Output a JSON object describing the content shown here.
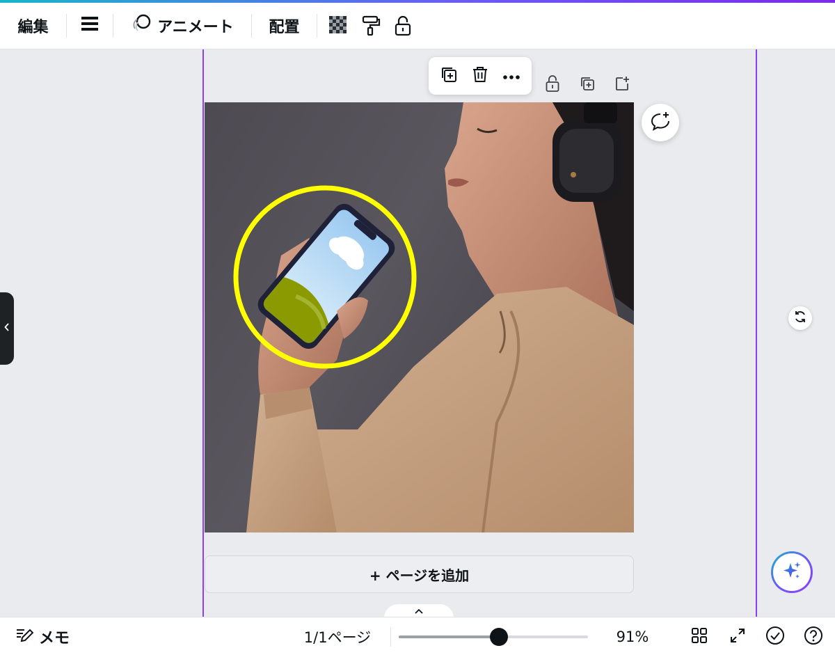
{
  "toolbar": {
    "edit_label": "編集",
    "animate_label": "アニメート",
    "arrange_label": "配置"
  },
  "canvas": {
    "add_page_label": "+ ページを追加"
  },
  "bottom": {
    "memo_label": "メモ",
    "page_counter": "1/1ページ",
    "zoom_value": "91%",
    "zoom_level": 0.53
  },
  "colors": {
    "selection": "#8b3dff",
    "highlight_ring": "#ffff00",
    "phone_sky": "#bfe0f7",
    "phone_grass": "#8a9a00",
    "sweater": "#c4a07e"
  }
}
